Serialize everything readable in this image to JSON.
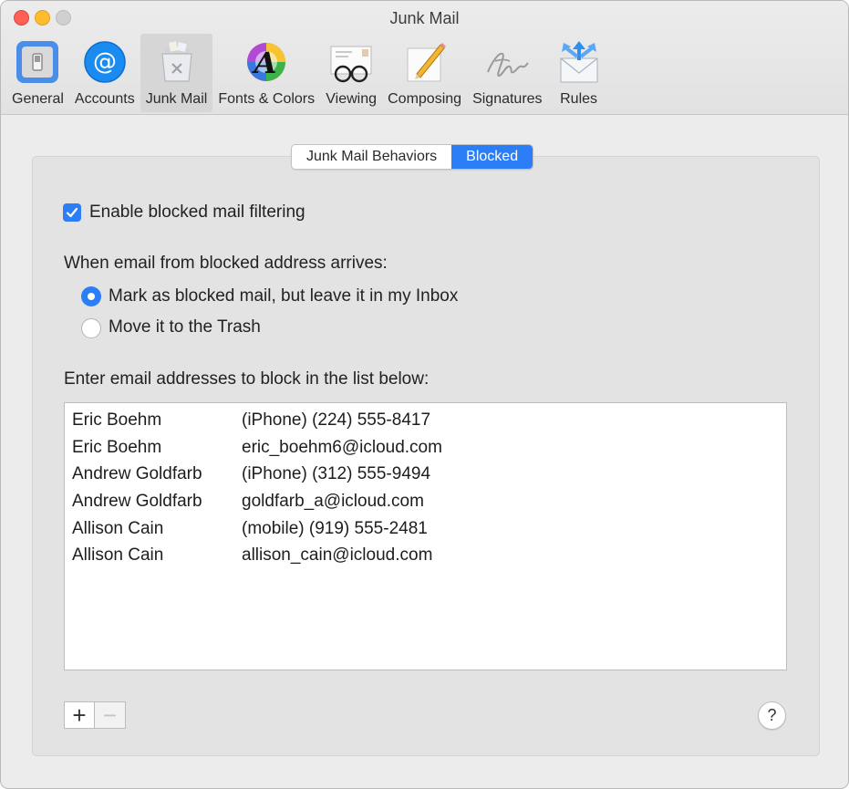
{
  "window": {
    "title": "Junk Mail"
  },
  "toolbar": {
    "items": [
      {
        "label": "General",
        "icon": "general-switch-icon"
      },
      {
        "label": "Accounts",
        "icon": "at-sign-icon"
      },
      {
        "label": "Junk Mail",
        "icon": "junk-bin-icon",
        "active": true
      },
      {
        "label": "Fonts & Colors",
        "icon": "color-wheel-font-icon"
      },
      {
        "label": "Viewing",
        "icon": "envelope-glasses-icon"
      },
      {
        "label": "Composing",
        "icon": "pencil-paper-icon"
      },
      {
        "label": "Signatures",
        "icon": "signature-icon"
      },
      {
        "label": "Rules",
        "icon": "envelope-arrows-icon"
      }
    ]
  },
  "tabs": {
    "behaviors": "Junk Mail Behaviors",
    "blocked": "Blocked"
  },
  "blocked": {
    "enable_label": "Enable blocked mail filtering",
    "enable_checked": true,
    "arrival_heading": "When email from blocked address arrives:",
    "option_mark": "Mark as blocked mail, but leave it in my Inbox",
    "option_trash": "Move it to the Trash",
    "list_heading": "Enter email addresses to block in the list below:",
    "entries": [
      {
        "name": "Eric Boehm",
        "address": "(iPhone) (224) 555-8417"
      },
      {
        "name": "Eric Boehm",
        "address": "eric_boehm6@icloud.com"
      },
      {
        "name": "Andrew Goldfarb",
        "address": "(iPhone) (312) 555-9494"
      },
      {
        "name": "Andrew Goldfarb",
        "address": "goldfarb_a@icloud.com"
      },
      {
        "name": "Allison Cain",
        "address": "(mobile) (919) 555-2481"
      },
      {
        "name": "Allison Cain",
        "address": "allison_cain@icloud.com"
      }
    ]
  },
  "buttons": {
    "add": "+",
    "remove": "−",
    "help": "?"
  },
  "colors": {
    "accent": "#2b7ef6"
  }
}
